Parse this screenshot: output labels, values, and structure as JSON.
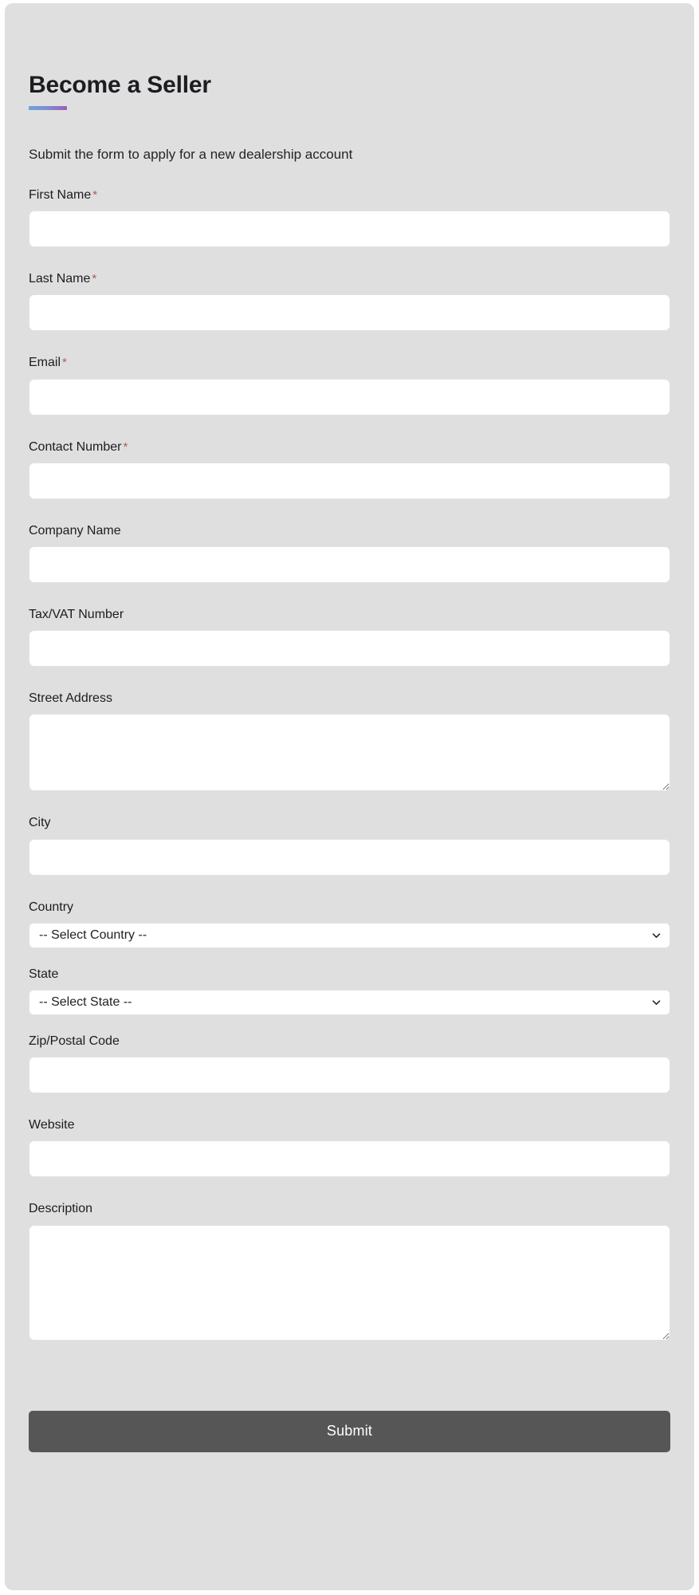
{
  "header": {
    "title": "Become a Seller",
    "subtitle": "Submit the form to apply for a new dealership account",
    "accent_gradient_start": "#6aa4da",
    "accent_gradient_end": "#9a5ebd"
  },
  "theme": {
    "page_background": "#ffffff",
    "card_background": "#dfdfdf",
    "input_background": "#ffffff",
    "input_border": "#e2e2e2",
    "text_color": "#1c1c22",
    "required_marker_color": "#b05a56",
    "submit_background": "#565656",
    "submit_text_color": "#ffffff"
  },
  "form": {
    "required_marker": "*",
    "fields": {
      "first_name": {
        "label": "First Name",
        "required": true,
        "value": "",
        "placeholder": ""
      },
      "last_name": {
        "label": "Last Name",
        "required": true,
        "value": "",
        "placeholder": ""
      },
      "email": {
        "label": "Email",
        "required": true,
        "value": "",
        "placeholder": ""
      },
      "contact_number": {
        "label": "Contact Number",
        "required": true,
        "value": "",
        "placeholder": ""
      },
      "company_name": {
        "label": "Company Name",
        "required": false,
        "value": "",
        "placeholder": ""
      },
      "tax_vat_number": {
        "label": "Tax/VAT Number",
        "required": false,
        "value": "",
        "placeholder": ""
      },
      "street_address": {
        "label": "Street Address",
        "required": false,
        "value": "",
        "placeholder": ""
      },
      "city": {
        "label": "City",
        "required": false,
        "value": "",
        "placeholder": ""
      },
      "country": {
        "label": "Country",
        "required": false,
        "selected": "-- Select Country --",
        "options": [
          "-- Select Country --"
        ]
      },
      "state": {
        "label": "State",
        "required": false,
        "selected": "-- Select State --",
        "options": [
          "-- Select State --"
        ]
      },
      "zip_postal_code": {
        "label": "Zip/Postal Code",
        "required": false,
        "value": "",
        "placeholder": ""
      },
      "website": {
        "label": "Website",
        "required": false,
        "value": "",
        "placeholder": ""
      },
      "description": {
        "label": "Description",
        "required": false,
        "value": "",
        "placeholder": ""
      }
    },
    "submit": {
      "label": "Submit"
    }
  }
}
